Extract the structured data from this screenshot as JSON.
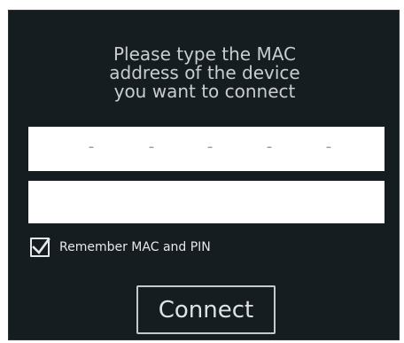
{
  "prompt": {
    "line1": "Please type the MAC",
    "line2": "address of the device",
    "line3": "you want to connect"
  },
  "mac_input": {
    "separators": [
      "-",
      "-",
      "-",
      "-",
      "-"
    ]
  },
  "pin_input": {
    "value": "",
    "placeholder": ""
  },
  "remember": {
    "label": "Remember MAC and PIN",
    "checked": true
  },
  "connect_button": {
    "label": "Connect"
  },
  "colors": {
    "background": "#161d20",
    "text": "#c9cdcf",
    "field": "#ffffff",
    "separator": "#9b9b9b"
  }
}
